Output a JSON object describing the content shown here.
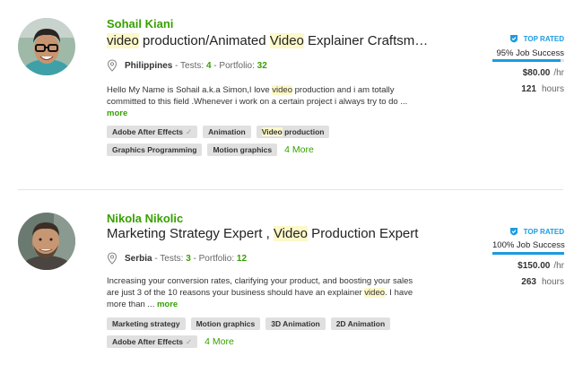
{
  "colors": {
    "accent_green": "#37a000",
    "badge_blue": "#1d9be0",
    "highlight": "#fcf8c9"
  },
  "freelancers": [
    {
      "name": "Sohail Kiani",
      "title_parts": [
        {
          "text": "video",
          "highlight": true
        },
        {
          "text": " production/Animated ",
          "highlight": false
        },
        {
          "text": "Video",
          "highlight": true
        },
        {
          "text": " Explainer Craftsmanship",
          "highlight": false
        }
      ],
      "country": "Philippines",
      "tests_label": " - Tests: ",
      "tests": "4",
      "portfolio_label": " - Portfolio: ",
      "portfolio": "32",
      "desc_before": "Hello My Name is Sohail a.k.a Simon,I love ",
      "desc_hl": "video",
      "desc_after": " production and i am totally committed to this field .Whenever i work on a certain project i always try to do ... ",
      "more": "more",
      "skills": [
        {
          "before": "Adobe After Effects",
          "hl": "",
          "after": "",
          "check": true
        },
        {
          "before": "Animation",
          "hl": "",
          "after": "",
          "check": false
        },
        {
          "before": "",
          "hl": "Video",
          "after": " production",
          "check": false
        },
        {
          "before": "Graphics Programming",
          "hl": "",
          "after": "",
          "check": false
        },
        {
          "before": "Motion graphics",
          "hl": "",
          "after": "",
          "check": false
        }
      ],
      "more_skills": "4 More",
      "badge": "TOP RATED",
      "job_success": "95% Job Success",
      "job_success_fraction": 0.95,
      "rate": "$80.00",
      "rate_unit": "/hr",
      "hours": "121",
      "hours_unit": "hours"
    },
    {
      "name": "Nikola Nikolic",
      "title_parts": [
        {
          "text": "Marketing Strategy Expert , ",
          "highlight": false
        },
        {
          "text": "Video",
          "highlight": true
        },
        {
          "text": " Production Expert",
          "highlight": false
        }
      ],
      "country": "Serbia",
      "tests_label": " - Tests: ",
      "tests": "3",
      "portfolio_label": " - Portfolio: ",
      "portfolio": "12",
      "desc_before": "Increasing your conversion rates, clarifying your product, and boosting your sales are just 3 of the 10 reasons your business should have an explainer ",
      "desc_hl": "video",
      "desc_after": ". I have more than ... ",
      "more": "more",
      "skills": [
        {
          "before": "Marketing strategy",
          "hl": "",
          "after": "",
          "check": false
        },
        {
          "before": "Motion graphics",
          "hl": "",
          "after": "",
          "check": false
        },
        {
          "before": "3D Animation",
          "hl": "",
          "after": "",
          "check": false
        },
        {
          "before": "2D Animation",
          "hl": "",
          "after": "",
          "check": false
        },
        {
          "before": "Adobe After Effects",
          "hl": "",
          "after": "",
          "check": true
        }
      ],
      "more_skills": "4 More",
      "badge": "TOP RATED",
      "job_success": "100% Job Success",
      "job_success_fraction": 1.0,
      "rate": "$150.00",
      "rate_unit": "/hr",
      "hours": "263",
      "hours_unit": "hours"
    }
  ]
}
